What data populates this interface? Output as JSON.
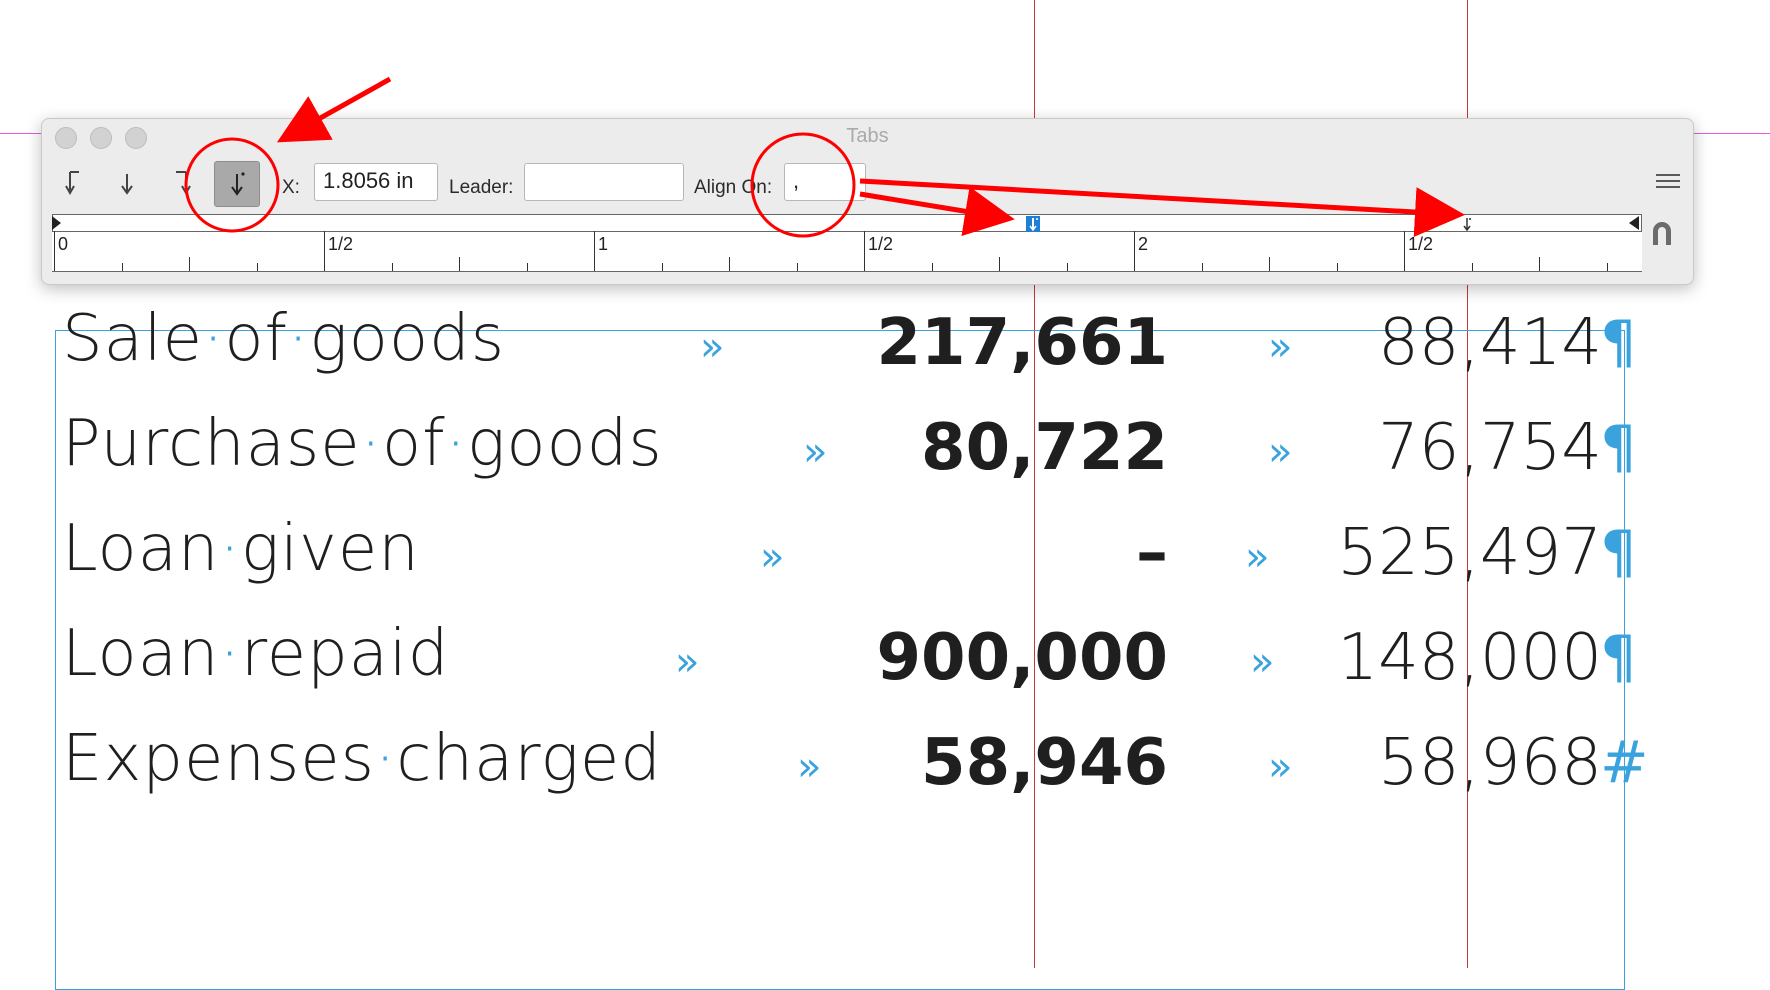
{
  "tabs_panel": {
    "title": "Tabs",
    "x_label": "X:",
    "x_value": "1.8056 in",
    "leader_label": "Leader:",
    "leader_value": "",
    "align_on_label": "Align On:",
    "align_on_value": ",",
    "tab_buttons": [
      {
        "name": "left-justified-tab",
        "selected": false
      },
      {
        "name": "center-justified-tab",
        "selected": false
      },
      {
        "name": "right-justified-tab",
        "selected": false
      },
      {
        "name": "align-to-decimal-tab",
        "selected": true
      }
    ],
    "ruler_labels": [
      "0",
      "1/2",
      "1",
      "1/2",
      "2",
      "1/2"
    ]
  },
  "table_rows": [
    {
      "label_parts": [
        "Sale",
        "of",
        "goods"
      ],
      "value1": "217,661",
      "value2": "88,414",
      "end_mark": "¶"
    },
    {
      "label_parts": [
        "Purchase",
        "of",
        "goods"
      ],
      "value1": "80,722",
      "value2": "76,754",
      "end_mark": "¶"
    },
    {
      "label_parts": [
        "Loan",
        "given"
      ],
      "value1": "–",
      "value2": "525,497",
      "end_mark": "¶"
    },
    {
      "label_parts": [
        "Loan",
        "repaid"
      ],
      "value1": "900,000",
      "value2": "148,000",
      "end_mark": "¶"
    },
    {
      "label_parts": [
        "Expenses",
        "charged"
      ],
      "value1": "58,946",
      "value2": "58,968",
      "end_mark": "#"
    }
  ],
  "tab_glyph": "»",
  "space_glyph": "·",
  "colors": {
    "annotation": "#ff0000",
    "hidden_chars": "#3aa3de",
    "guide_vertical": "#c43a3a",
    "guide_horizontal": "#e35ce3",
    "selected_tab_bg": "#a9a9a9"
  }
}
